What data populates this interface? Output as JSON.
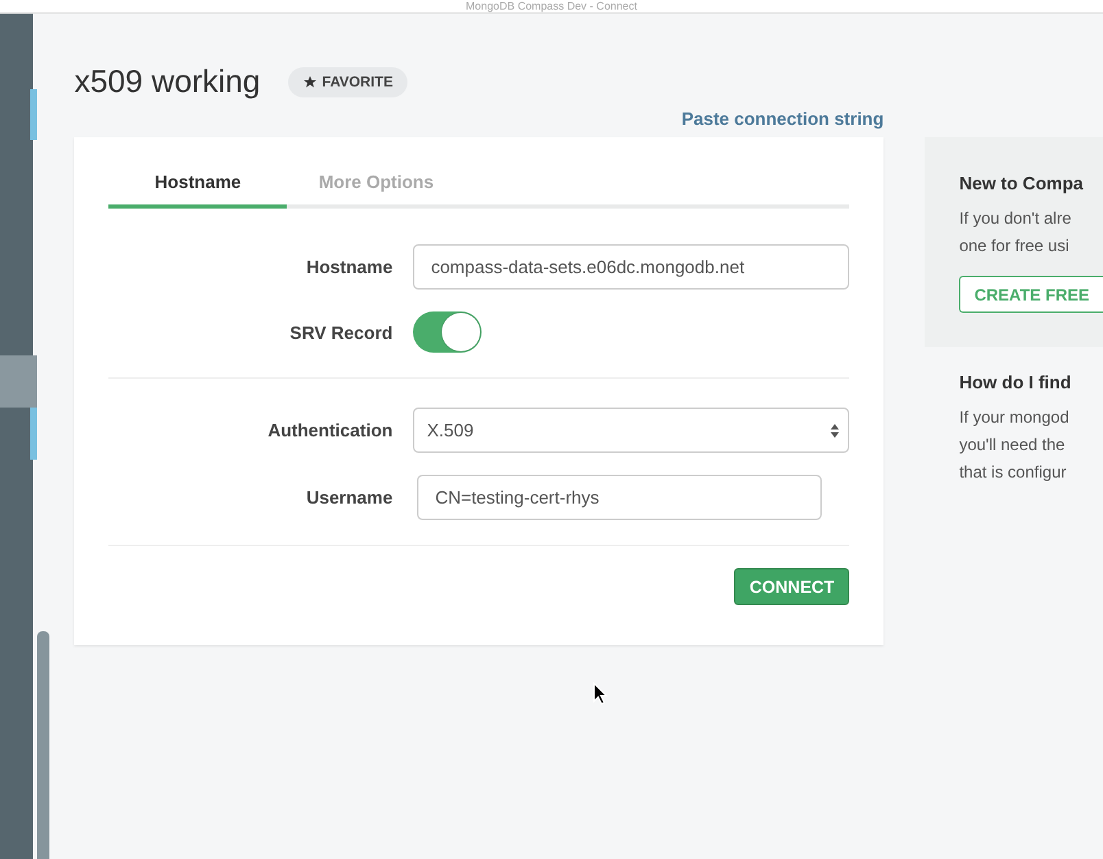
{
  "window": {
    "title": "MongoDB Compass Dev - Connect"
  },
  "sidebar": {
    "markers": [
      {
        "selected": false
      },
      {
        "selected": true
      }
    ]
  },
  "connection": {
    "name": "x509 working",
    "favorite_label": "FAVORITE",
    "paste_link": "Paste connection string"
  },
  "tabs": [
    {
      "label": "Hostname",
      "selected": true
    },
    {
      "label": "More Options",
      "selected": false
    }
  ],
  "form": {
    "hostname": {
      "label": "Hostname",
      "value": "compass-data-sets.e06dc.mongodb.net"
    },
    "srv": {
      "label": "SRV Record",
      "on": true
    },
    "authentication": {
      "label": "Authentication",
      "value": "X.509"
    },
    "username": {
      "label": "Username",
      "value": "CN=testing-cert-rhys"
    },
    "connect_button": "CONNECT"
  },
  "help": {
    "new_title": "New to Compa",
    "new_lines": [
      "If you don't alre",
      "one for free usi"
    ],
    "create_button": "CREATE FREE",
    "find_title": "How do I find",
    "find_lines": [
      "If your mongod",
      "you'll need the",
      "that is configur"
    ]
  }
}
